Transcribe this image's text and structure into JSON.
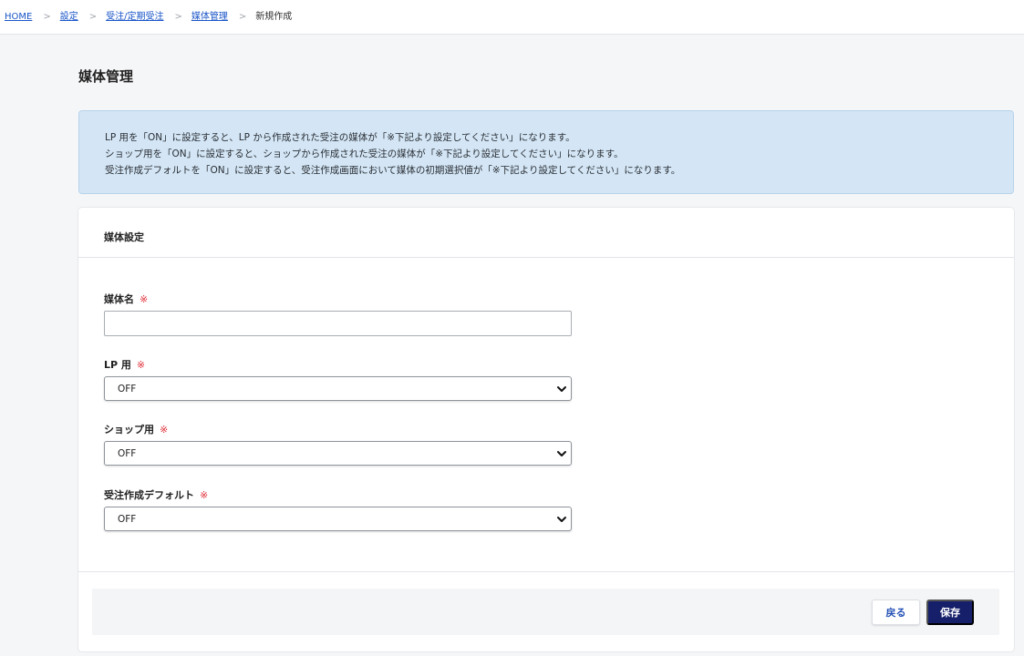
{
  "breadcrumb": {
    "items": [
      "HOME",
      "設定",
      "受注/定期受注",
      "媒体管理"
    ],
    "separator": ">",
    "current": "新規作成"
  },
  "page": {
    "title": "媒体管理"
  },
  "info": {
    "lines": [
      "LP 用を「ON」に設定すると、LP から作成された受注の媒体が「※下記より設定してください」になります。",
      "ショップ用を「ON」に設定すると、ショップから作成された受注の媒体が「※下記より設定してください」になります。",
      "受注作成デフォルトを「ON」に設定すると、受注作成画面において媒体の初期選択値が「※下記より設定してください」になります。"
    ]
  },
  "form": {
    "section_title": "媒体設定",
    "required_mark": "※",
    "fields": {
      "name": {
        "label": "媒体名",
        "value": "",
        "placeholder": ""
      },
      "lp": {
        "label": "LP 用",
        "value": "OFF"
      },
      "shop": {
        "label": "ショップ用",
        "value": "OFF"
      },
      "order_default": {
        "label": "受注作成デフォルト",
        "value": "OFF"
      }
    },
    "buttons": {
      "back": "戻る",
      "save": "保存"
    }
  },
  "colors": {
    "link": "#1a56c9",
    "required": "#e0303a",
    "info_bg": "#d4e6f5",
    "primary_button": "#16206a"
  },
  "icons": {
    "select": "chevron-down-icon"
  }
}
